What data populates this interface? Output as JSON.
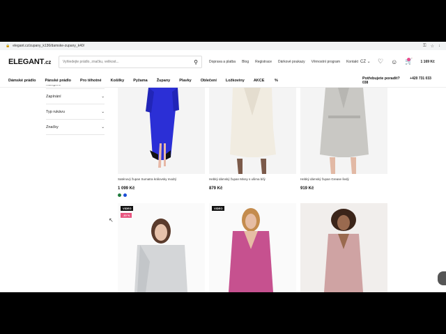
{
  "browser": {
    "url": "elegant.cz/zupany_k136/damske-zupany_k40/"
  },
  "header": {
    "logo": "ELEGANT",
    "logo_suffix": ".cz",
    "search_placeholder": "Vyhledejte prádlo, značku, velikost...",
    "links": [
      "Doprava a platba",
      "Blog",
      "Registrace",
      "Dárkové poukazy",
      "Věrnostní program",
      "Kontakt"
    ],
    "lang": "CZ",
    "cart_total": "1 169 Kč"
  },
  "nav": {
    "items": [
      "Dámské prádlo",
      "Pánské prádlo",
      "Pro těhotné",
      "Košilky",
      "Pyžama",
      "Župany",
      "Plavky",
      "Oblečení",
      "Ložkoviny"
    ],
    "akce": "AKCE",
    "help_label": "Potřebujete poradit?",
    "help_phone": "+420 731 033 038"
  },
  "filters": {
    "top": "Kategorie",
    "items": [
      "Zapínání",
      "Typ rukávu",
      "Značky"
    ]
  },
  "products": [
    {
      "name": "Saténový župan Sumatra královsky modrý",
      "price": "1 099 Kč",
      "swatches": [
        "#1e7a3c",
        "#1c4fd6"
      ]
    },
    {
      "name": "Hebký dámský župan Missy s ušima bílý",
      "price": "879 Kč"
    },
    {
      "name": "Hebký dámský župan Grease šedý",
      "price": "919 Kč"
    },
    {
      "tag_video": "VIDEO",
      "tag_sale": "-10 %"
    },
    {
      "tag_video": "VIDEO"
    },
    {}
  ],
  "colors": {
    "accent": "#e8547f",
    "royal_blue": "#2b2fd6",
    "pink": "#c6518f"
  }
}
